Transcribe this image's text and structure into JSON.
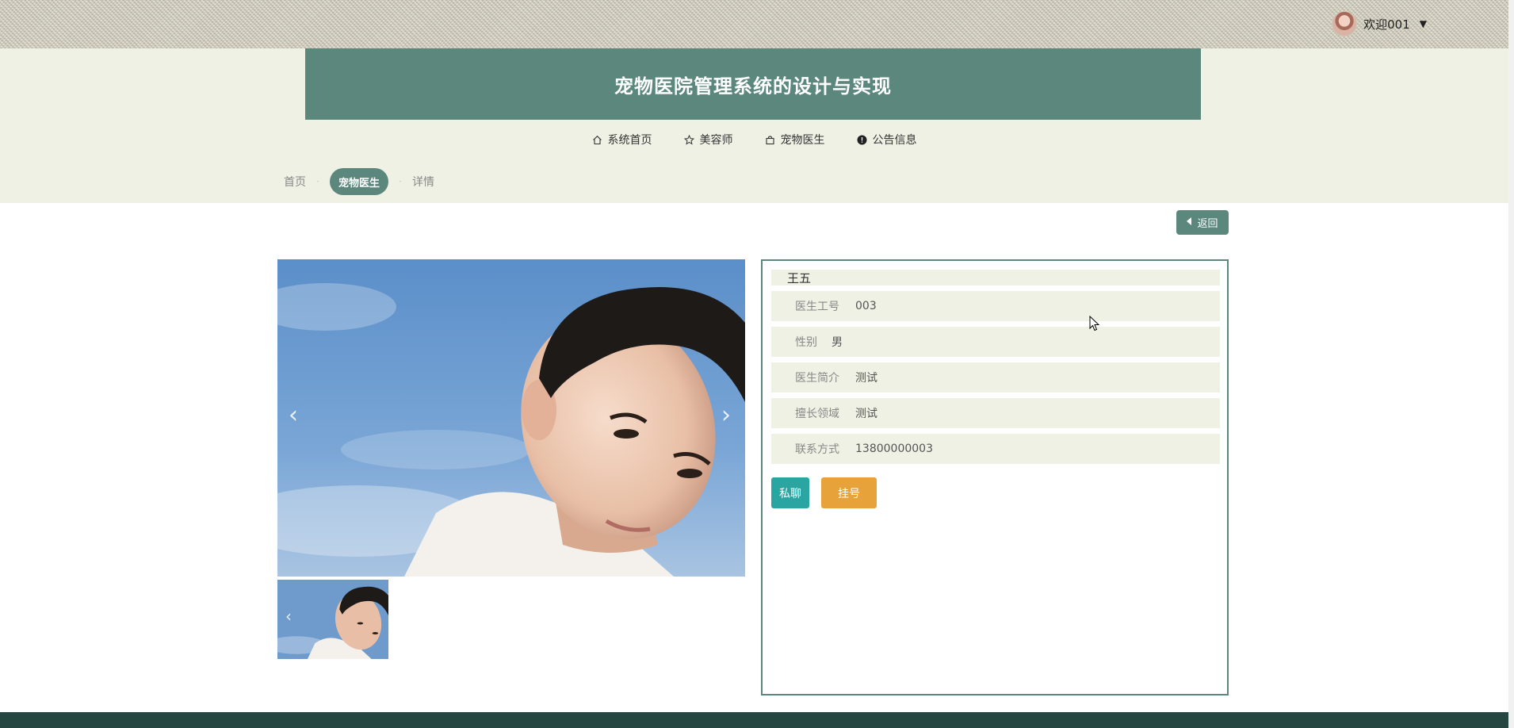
{
  "header": {
    "title": "宠物医院管理系统的设计与实现",
    "user_label": "欢迎001"
  },
  "nav": {
    "items": [
      {
        "label": "系统首页",
        "icon": "home-icon"
      },
      {
        "label": "美容师",
        "icon": "star-icon"
      },
      {
        "label": "宠物医生",
        "icon": "bag-icon"
      },
      {
        "label": "公告信息",
        "icon": "info-icon"
      }
    ]
  },
  "breadcrumb": {
    "home": "首页",
    "current": "宠物医生",
    "detail": "详情"
  },
  "back_button": "返回",
  "doctor": {
    "name": "王五",
    "fields": [
      {
        "label": "医生工号",
        "value": "003"
      },
      {
        "label": "性别",
        "value": "男"
      },
      {
        "label": "医生简介",
        "value": "测试"
      },
      {
        "label": "擅长领域",
        "value": "测试"
      },
      {
        "label": "联系方式",
        "value": "13800000003"
      }
    ]
  },
  "actions": {
    "chat": "私聊",
    "register": "挂号"
  },
  "colors": {
    "primary": "#5b877c",
    "header_bg": "#f0f1e5",
    "chat_btn": "#2ba5a2",
    "register_btn": "#e8a23a",
    "footer": "#264641"
  }
}
